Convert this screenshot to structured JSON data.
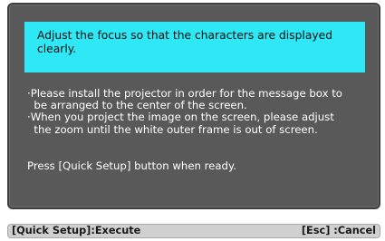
{
  "dialog": {
    "focus_message": {
      "line1": "Adjust the focus so that the characters are displayed",
      "line2": "clearly."
    },
    "instructions": [
      "·Please install the projector in order for the message box to",
      "  be arranged to the center of the screen.",
      "·When you project the image on the screen, please adjust",
      "  the zoom until the white outer frame is out of screen."
    ],
    "ready_text": "Press [Quick Setup] button when ready."
  },
  "bottom_bar": {
    "execute_label": "[Quick Setup]:Execute",
    "cancel_label": "[Esc] :Cancel"
  },
  "colors": {
    "focus_box_background": "#2ee9f5",
    "dialog_background": "#595959",
    "bar_background": "#d0d0d0"
  }
}
